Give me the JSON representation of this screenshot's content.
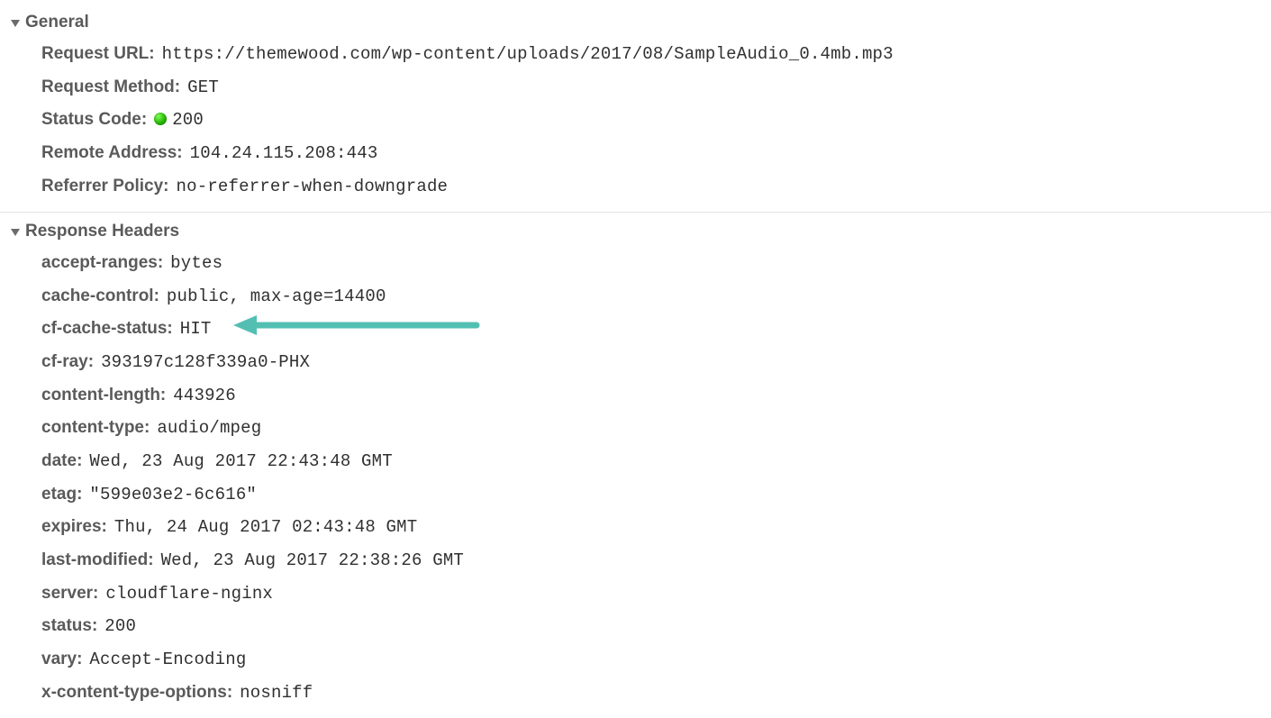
{
  "sections": {
    "general": {
      "title": "General",
      "items": [
        {
          "label": "Request URL:",
          "value": "https://themewood.com/wp-content/uploads/2017/08/SampleAudio_0.4mb.mp3"
        },
        {
          "label": "Request Method:",
          "value": "GET"
        },
        {
          "label": "Status Code:",
          "value": "200",
          "status_dot": true
        },
        {
          "label": "Remote Address:",
          "value": "104.24.115.208:443"
        },
        {
          "label": "Referrer Policy:",
          "value": "no-referrer-when-downgrade"
        }
      ]
    },
    "response_headers": {
      "title": "Response Headers",
      "items": [
        {
          "label": "accept-ranges:",
          "value": "bytes"
        },
        {
          "label": "cache-control:",
          "value": "public, max-age=14400"
        },
        {
          "label": "cf-cache-status:",
          "value": "HIT",
          "highlight_arrow": true
        },
        {
          "label": "cf-ray:",
          "value": "393197c128f339a0-PHX"
        },
        {
          "label": "content-length:",
          "value": "443926"
        },
        {
          "label": "content-type:",
          "value": "audio/mpeg"
        },
        {
          "label": "date:",
          "value": "Wed, 23 Aug 2017 22:43:48 GMT"
        },
        {
          "label": "etag:",
          "value": "\"599e03e2-6c616\""
        },
        {
          "label": "expires:",
          "value": "Thu, 24 Aug 2017 02:43:48 GMT"
        },
        {
          "label": "last-modified:",
          "value": "Wed, 23 Aug 2017 22:38:26 GMT"
        },
        {
          "label": "server:",
          "value": "cloudflare-nginx"
        },
        {
          "label": "status:",
          "value": "200"
        },
        {
          "label": "vary:",
          "value": "Accept-Encoding"
        },
        {
          "label": "x-content-type-options:",
          "value": "nosniff"
        }
      ]
    }
  },
  "annotation": {
    "arrow_color": "#53bfb3"
  }
}
